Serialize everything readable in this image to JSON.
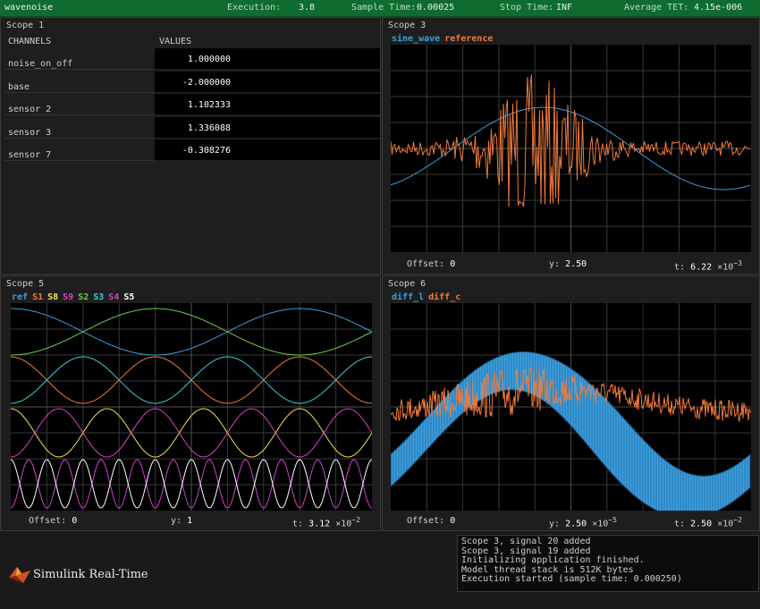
{
  "topbar": {
    "app_name": "wavenoise",
    "execution_label": "Execution:",
    "execution_value": "3.8",
    "sample_time_label": "Sample Time:",
    "sample_time_value": "0.00025",
    "stop_time_label": "Stop Time:",
    "stop_time_value": "INF",
    "tet_label": "Average TET:",
    "tet_value": "4.15e-006"
  },
  "scope1": {
    "title": "Scope 1",
    "col_channels": "CHANNELS",
    "col_values": "VALUES",
    "rows": [
      {
        "name": "noise_on_off",
        "value": "1.000000"
      },
      {
        "name": "base",
        "value": "-2.000000"
      },
      {
        "name": "sensor 2",
        "value": "1.102333"
      },
      {
        "name": "sensor 3",
        "value": "1.336088"
      },
      {
        "name": "sensor 7",
        "value": "-0.308276"
      }
    ]
  },
  "scope3": {
    "title": "Scope 3",
    "legend": [
      {
        "label": "sine_wave",
        "color": "#3a9ee0"
      },
      {
        "label": "reference",
        "color": "#f07a3a"
      }
    ],
    "offset_label": "Offset:",
    "offset_value": "0",
    "y_label": "y:",
    "y_value": "2.50",
    "t_label": "t:",
    "t_value": "6.22",
    "t_mult": "×10",
    "t_exp": "−3"
  },
  "scope5": {
    "title": "Scope 5",
    "legend": [
      {
        "label": "ref",
        "color": "#3a9ee0"
      },
      {
        "label": "S1",
        "color": "#f07a3a"
      },
      {
        "label": "S8",
        "color": "#f4e24a"
      },
      {
        "label": "S9",
        "color": "#e040c0"
      },
      {
        "label": "S2",
        "color": "#6ccf4a"
      },
      {
        "label": "S3",
        "color": "#3ad0d8"
      },
      {
        "label": "S4",
        "color": "#d040d0"
      },
      {
        "label": "S5",
        "color": "#ffffff"
      }
    ],
    "offset_label": "Offset:",
    "offset_value": "0",
    "y_label": "y:",
    "y_value": "1",
    "t_label": "t:",
    "t_value": "3.12",
    "t_mult": "×10",
    "t_exp": "−2"
  },
  "scope6": {
    "title": "Scope 6",
    "legend": [
      {
        "label": "diff_l",
        "color": "#3a9ee0"
      },
      {
        "label": "diff_c",
        "color": "#f07a3a"
      }
    ],
    "offset_label": "Offset:",
    "offset_value": "0",
    "y_label": "y:",
    "y_value": "2.50",
    "y_mult": "×10",
    "y_exp": "−5",
    "t_label": "t:",
    "t_value": "2.50",
    "t_mult": "×10",
    "t_exp": "−2"
  },
  "console": {
    "lines": [
      "Scope 3, signal 20 added",
      "Scope 3, signal 19 added",
      "Initializing application finished.",
      "Model thread stack is 512K bytes",
      "Execution started (sample time: 0.000250)"
    ]
  },
  "brand": {
    "name": "Simulink Real-Time"
  }
}
